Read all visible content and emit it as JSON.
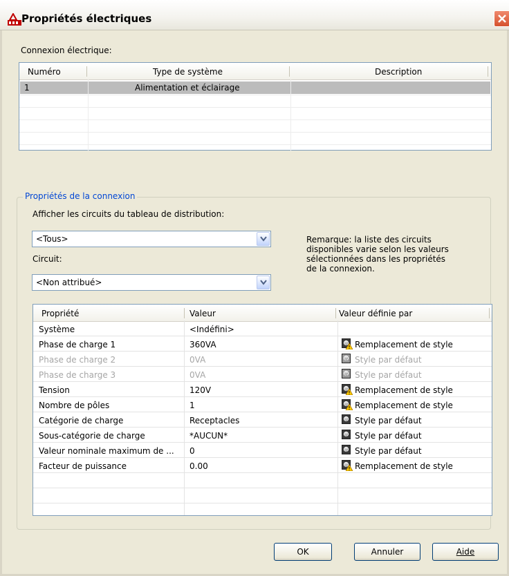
{
  "window": {
    "title": "Propriétés électriques"
  },
  "connexion": {
    "label": "Connexion électrique:",
    "columns": [
      "Numéro",
      "Type de système",
      "Description"
    ],
    "rows": [
      {
        "numero": "1",
        "type": "Alimentation et éclairage",
        "description": ""
      }
    ]
  },
  "group": {
    "title": "Propriétés de la connexion",
    "show_circuits_label": "Afficher les circuits du tableau de distribution:",
    "show_circuits_value": "<Tous>",
    "circuit_label": "Circuit:",
    "circuit_value": "<Non attribué>",
    "note_lines": [
      "Remarque: la liste des circuits",
      "disponibles varie selon les valeurs",
      "sélectionnées dans les propriétés",
      "de la connexion."
    ]
  },
  "properties": {
    "columns": [
      "Propriété",
      "Valeur",
      "Valeur définie par"
    ],
    "rows": [
      {
        "name": "Système",
        "value": "<Indéfini>",
        "source": "",
        "icon": "",
        "disabled": false
      },
      {
        "name": "Phase de charge 1",
        "value": "360VA",
        "source": "Remplacement de style",
        "icon": "style-override-icon",
        "disabled": false
      },
      {
        "name": "Phase de charge 2",
        "value": "0VA",
        "source": "Style par défaut",
        "icon": "style-default-icon",
        "disabled": true
      },
      {
        "name": "Phase de charge 3",
        "value": "0VA",
        "source": "Style par défaut",
        "icon": "style-default-icon",
        "disabled": true
      },
      {
        "name": "Tension",
        "value": "120V",
        "source": "Remplacement de style",
        "icon": "style-override-icon",
        "disabled": false
      },
      {
        "name": "Nombre de pôles",
        "value": "1",
        "source": "Remplacement de style",
        "icon": "style-override-icon",
        "disabled": false
      },
      {
        "name": "Catégorie de charge",
        "value": "Receptacles",
        "source": "Style par défaut",
        "icon": "style-default-icon",
        "disabled": false
      },
      {
        "name": "Sous-catégorie de charge",
        "value": "*AUCUN*",
        "source": "Style par défaut",
        "icon": "style-default-icon",
        "disabled": false
      },
      {
        "name": "Valeur nominale maximum de ...",
        "value": "0",
        "source": "Style par défaut",
        "icon": "style-default-icon",
        "disabled": false
      },
      {
        "name": "Facteur de puissance",
        "value": "0.00",
        "source": "Remplacement de style",
        "icon": "style-override-icon",
        "disabled": false
      }
    ]
  },
  "buttons": {
    "ok": "OK",
    "cancel": "Annuler",
    "help": "Aide"
  },
  "colors": {
    "selection": "#bcbcbc",
    "group_title": "#0046d5",
    "close": "#d5512e"
  }
}
